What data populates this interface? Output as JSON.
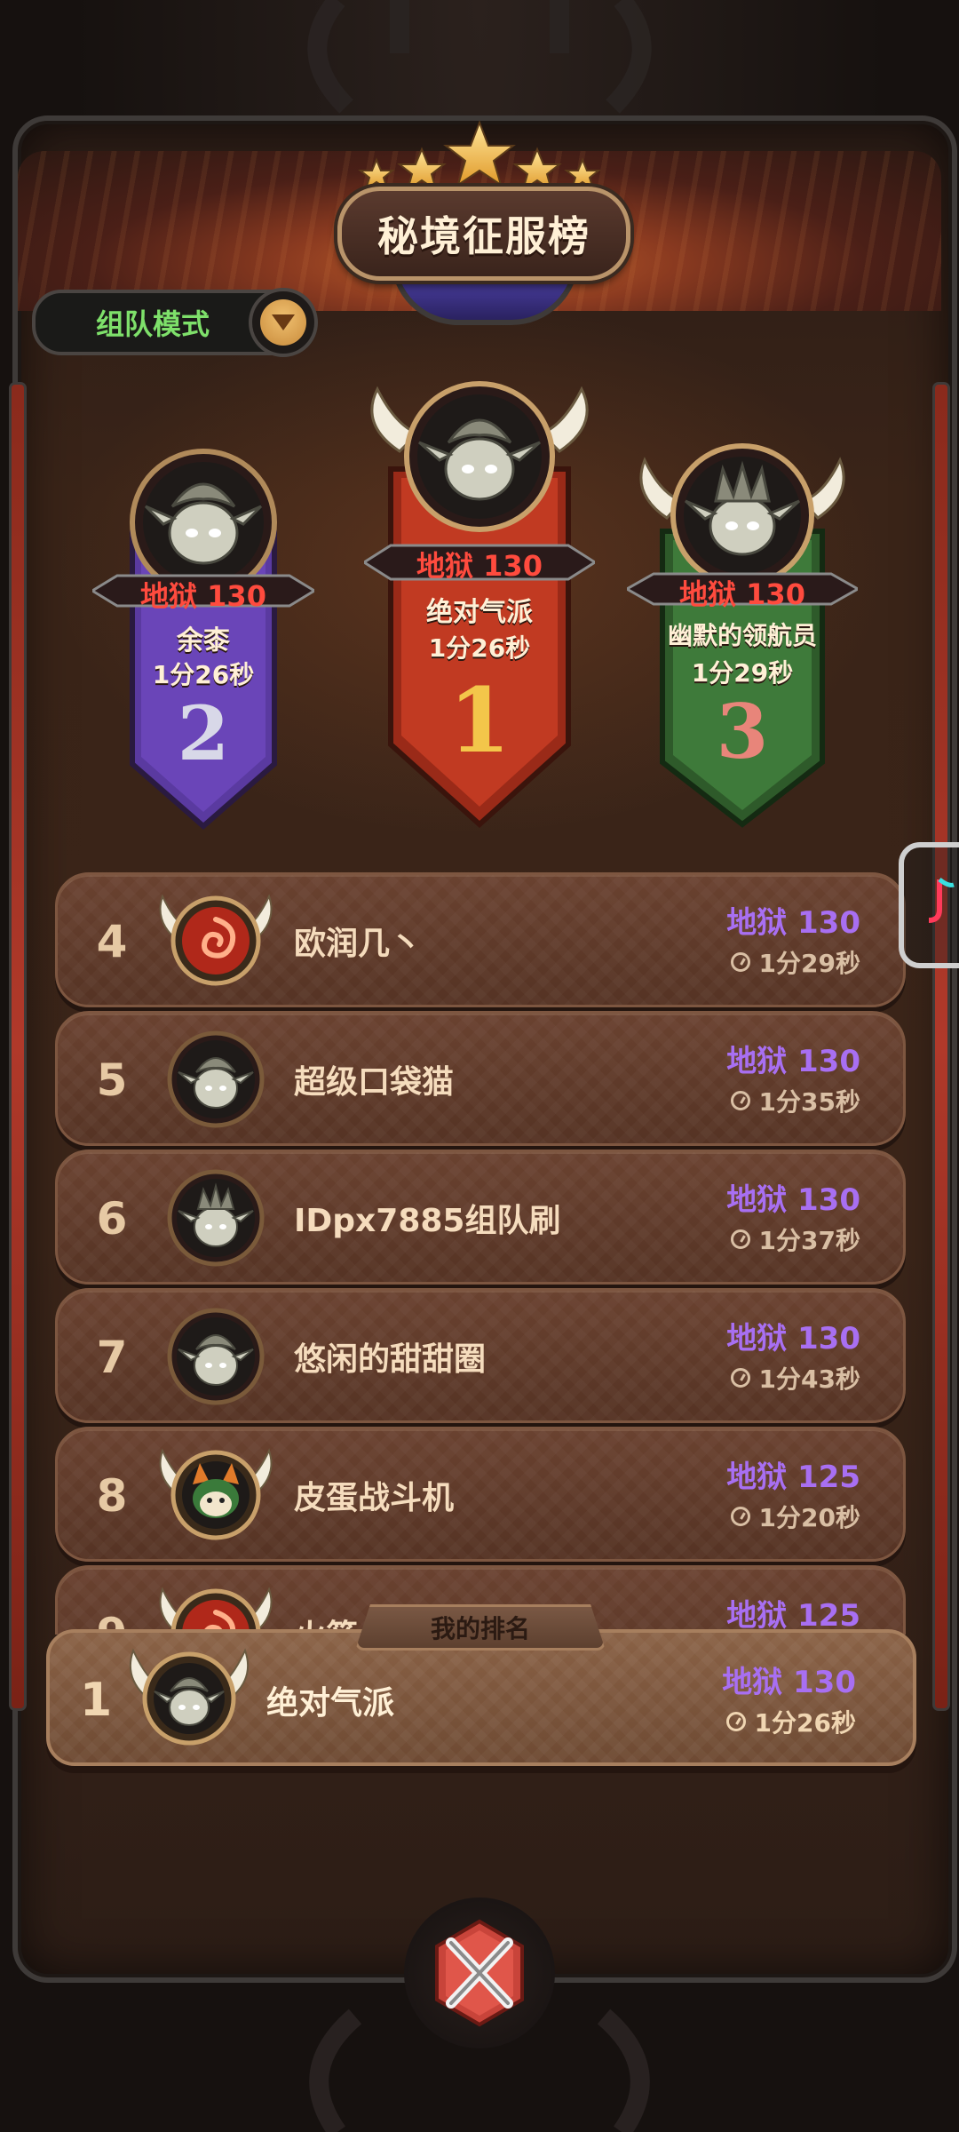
{
  "header": {
    "title": "秘境征服榜",
    "stars": 5
  },
  "mode_selector": {
    "label": "组队模式",
    "arrow_icon": "chevron-down-icon"
  },
  "podium": [
    {
      "rank": "2",
      "difficulty": "地狱 130",
      "name": "余桼",
      "time": "1分26秒",
      "color": "#6a45b8"
    },
    {
      "rank": "1",
      "difficulty": "地狱 130",
      "name": "绝对气派",
      "time": "1分26秒",
      "color": "#c13a22"
    },
    {
      "rank": "3",
      "difficulty": "地狱 130",
      "name": "幽默的领航员",
      "time": "1分29秒",
      "color": "#3e7a3a"
    }
  ],
  "leaderboard": [
    {
      "rank": "4",
      "name": "欧润几丶",
      "difficulty": "地狱 130",
      "time": "1分29秒",
      "avatar": "fire-swirl-icon"
    },
    {
      "rank": "5",
      "name": "超级口袋猫",
      "difficulty": "地狱 130",
      "time": "1分35秒",
      "avatar": "elf-avatar"
    },
    {
      "rank": "6",
      "name": "IDpx7885组队刷",
      "difficulty": "地狱 130",
      "time": "1分37秒",
      "avatar": "elf-avatar"
    },
    {
      "rank": "7",
      "name": "悠闲的甜甜圈",
      "difficulty": "地狱 130",
      "time": "1分43秒",
      "avatar": "elf-avatar"
    },
    {
      "rank": "8",
      "name": "皮蛋战斗机",
      "difficulty": "地狱 125",
      "time": "1分20秒",
      "avatar": "fox-avatar"
    },
    {
      "rank": "9",
      "name": "火箭",
      "difficulty": "地狱 125",
      "time": "",
      "avatar": "fire-swirl-icon"
    }
  ],
  "my_rank": {
    "tab_label": "我的排名",
    "rank": "1",
    "name": "绝对气派",
    "difficulty": "地狱 130",
    "time": "1分26秒"
  },
  "colors": {
    "difficulty": "#a86ff2",
    "podium_difficulty": "#ff4b3e",
    "mode_label": "#7ee06a"
  }
}
